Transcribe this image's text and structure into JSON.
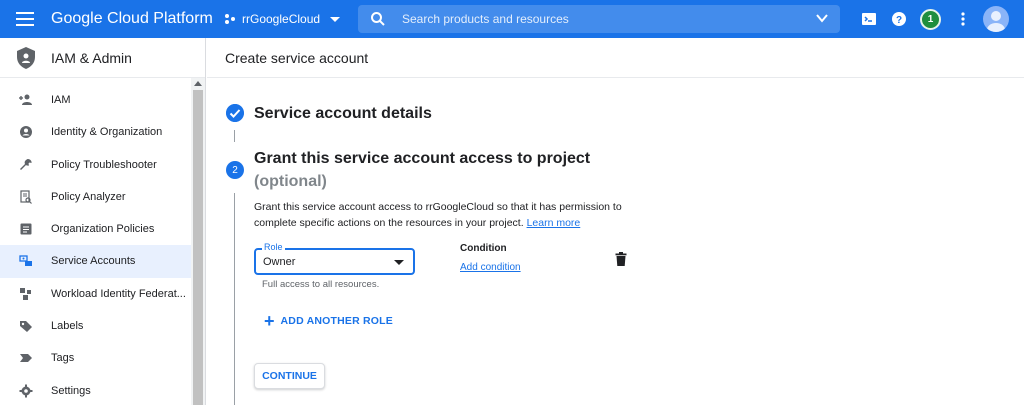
{
  "topbar": {
    "brand": "Google Cloud Platform",
    "project": "rrGoogleCloud",
    "search_placeholder": "Search products and resources",
    "notification_count": "1",
    "accent_color": "#1a73e8"
  },
  "sidebar": {
    "title": "IAM & Admin",
    "items": [
      {
        "label": "IAM",
        "icon": "person-add-icon"
      },
      {
        "label": "Identity & Organization",
        "icon": "account-circle-icon"
      },
      {
        "label": "Policy Troubleshooter",
        "icon": "wrench-icon"
      },
      {
        "label": "Policy Analyzer",
        "icon": "document-search-icon"
      },
      {
        "label": "Organization Policies",
        "icon": "list-document-icon"
      },
      {
        "label": "Service Accounts",
        "icon": "service-account-icon"
      },
      {
        "label": "Workload Identity Federat...",
        "icon": "workload-identity-icon"
      },
      {
        "label": "Labels",
        "icon": "label-icon"
      },
      {
        "label": "Tags",
        "icon": "tag-icon"
      },
      {
        "label": "Settings",
        "icon": "gear-icon"
      }
    ],
    "active_item": "Service Accounts"
  },
  "main": {
    "page_title": "Create service account",
    "step1": {
      "title": "Service account details"
    },
    "step2": {
      "number": "2",
      "title": "Grant this service account access to project",
      "subtitle": "(optional)",
      "description": "Grant this service account access to rrGoogleCloud so that it has permission to complete specific actions on the resources in your project.",
      "learn_more": "Learn more"
    },
    "role": {
      "label": "Role",
      "value": "Owner",
      "help": "Full access to all resources."
    },
    "condition": {
      "title": "Condition",
      "link": "Add condition"
    },
    "add_role_label": "ADD ANOTHER ROLE",
    "continue_label": "CONTINUE"
  }
}
